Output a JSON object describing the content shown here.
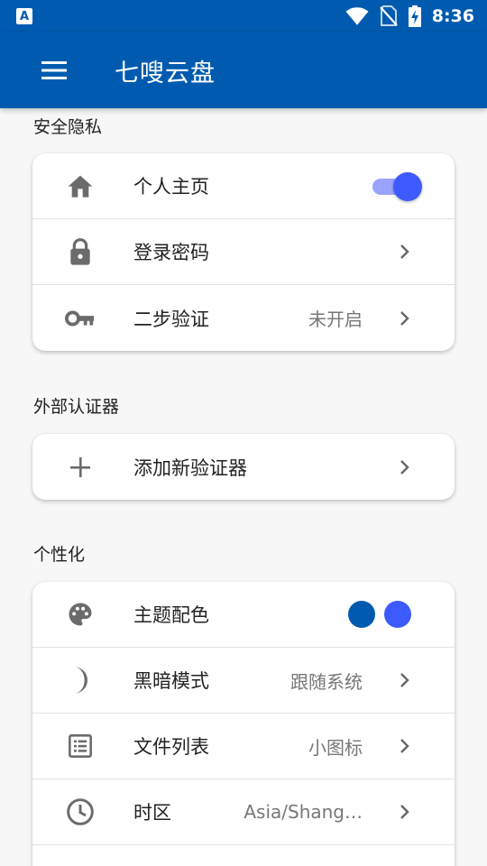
{
  "status_bar": {
    "notification_icon": "A",
    "time": "8:36",
    "icons": [
      "wifi-icon",
      "no-sim-icon",
      "battery-charging-icon"
    ]
  },
  "app_bar": {
    "title": "七嗖云盘",
    "menu_icon": "hamburger-menu-icon"
  },
  "sections": {
    "privacy": {
      "title": "安全隐私",
      "items": [
        {
          "label": "个人主页",
          "icon": "home-icon",
          "control": "toggle",
          "checked": true
        },
        {
          "label": "登录密码",
          "icon": "lock-icon",
          "control": "chevron"
        },
        {
          "label": "二步验证",
          "icon": "key-icon",
          "value": "未开启",
          "control": "chevron"
        }
      ]
    },
    "authenticators": {
      "title": "外部认证器",
      "items": [
        {
          "label": "添加新验证器",
          "icon": "plus-icon",
          "control": "chevron"
        }
      ]
    },
    "personalization": {
      "title": "个性化",
      "items": [
        {
          "label": "主题配色",
          "icon": "palette-icon",
          "control": "swatches"
        },
        {
          "label": "黑暗模式",
          "icon": "moon-icon",
          "value": "跟随系统",
          "control": "chevron"
        },
        {
          "label": "文件列表",
          "icon": "list-icon",
          "value": "小图标",
          "control": "chevron"
        },
        {
          "label": "时区",
          "icon": "clock-icon",
          "value": "Asia/Shang…",
          "control": "chevron"
        }
      ]
    }
  },
  "colors": {
    "primary": "#005bb0",
    "accent": "#3d5afe",
    "toggle_track": "#9aa3ff",
    "icon_gray": "#6b6b6b",
    "swatch_primary": "#005bb0",
    "swatch_accent": "#3d5afe"
  }
}
